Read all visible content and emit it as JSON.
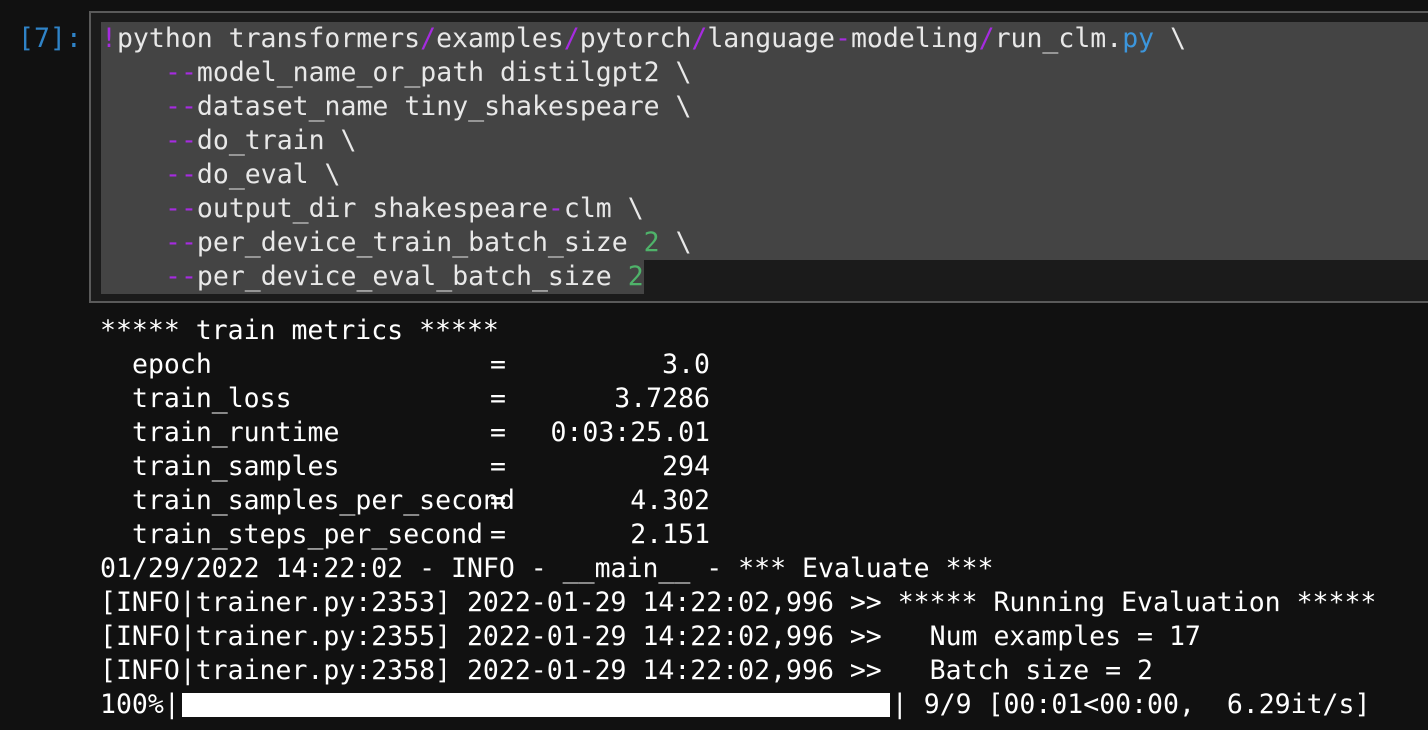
{
  "cell": {
    "prompt": "[7]:",
    "command": {
      "bang": "!",
      "path_parts": [
        "python transformers",
        "/",
        "examples",
        "/",
        "pytorch",
        "/",
        "language",
        "-",
        "modeling",
        "/",
        "run_clm",
        ".",
        "py",
        " \\"
      ],
      "args": [
        {
          "flag": "--",
          "text": "model_name_or_path distilgpt2 \\"
        },
        {
          "flag": "--",
          "text": "dataset_name tiny_shakespeare \\"
        },
        {
          "flag": "--",
          "text": "do_train \\"
        },
        {
          "flag": "--",
          "text": "do_eval \\"
        },
        {
          "flag": "--",
          "text_a": "output_dir shakespeare",
          "dash": "-",
          "text_b": "clm \\"
        },
        {
          "flag": "--",
          "text": "per_device_train_batch_size ",
          "num": "2",
          "tail": " \\"
        },
        {
          "flag": "--",
          "text": "per_device_eval_batch_size ",
          "num": "2"
        }
      ]
    }
  },
  "output": {
    "header": "***** train metrics *****",
    "metrics": [
      {
        "name": "epoch",
        "eq": "=",
        "value": "3.0"
      },
      {
        "name": "train_loss",
        "eq": "=",
        "value": "3.7286"
      },
      {
        "name": "train_runtime",
        "eq": "=",
        "value": "0:03:25.01"
      },
      {
        "name": "train_samples",
        "eq": "=",
        "value": "294"
      },
      {
        "name": "train_samples_per_second",
        "eq": "=",
        "value": "4.302"
      },
      {
        "name": "train_steps_per_second",
        "eq": "=",
        "value": "2.151"
      }
    ],
    "log_lines": [
      "01/29/2022 14:22:02 - INFO - __main__ - *** Evaluate ***",
      "[INFO|trainer.py:2353] 2022-01-29 14:22:02,996 >> ***** Running Evaluation *****",
      "[INFO|trainer.py:2355] 2022-01-29 14:22:02,996 >>   Num examples = 17",
      "[INFO|trainer.py:2358] 2022-01-29 14:22:02,996 >>   Batch size = 2"
    ],
    "progress": {
      "percent_label": "100%|",
      "fraction": 1.0,
      "end_label": "| 9/9 [00:01<00:00,  6.29it/s]"
    }
  },
  "colors": {
    "background": "#111111",
    "prompt": "#2f83c7",
    "operator": "#a62be0",
    "keyword": "#3c96dc",
    "number": "#4fb36a",
    "code_bg": "#444444"
  }
}
